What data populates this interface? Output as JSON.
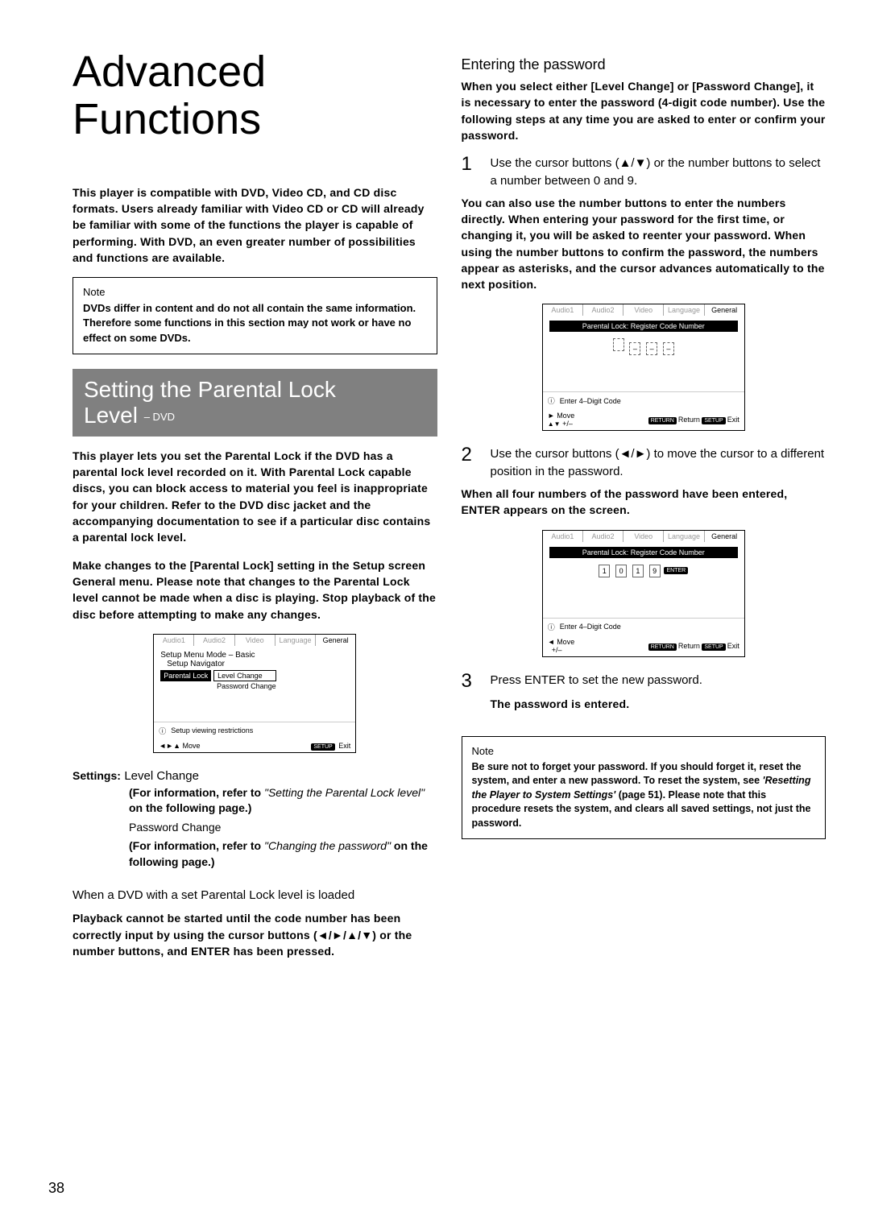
{
  "page_number": "38",
  "title": "Advanced Functions",
  "intro_para": "This player is compatible with DVD, Video CD, and CD disc formats. Users already familiar with Video CD or CD will already be familiar with some of the functions the player is capable of performing. With DVD, an even greater number of possibilities and functions are available.",
  "note1": {
    "label": "Note",
    "text": "DVDs differ in content and do not all contain the same information. Therefore some functions in this section may not work or have no effect on some DVDs."
  },
  "section_banner": {
    "line1": "Setting the Parental Lock",
    "line2_a": "Level",
    "line2_b": "– DVD"
  },
  "parental_para1": "This player lets you set the Parental Lock if the DVD has a parental lock level recorded on it. With Parental Lock capable discs, you can block access to material you feel is inappropriate for your children. Refer to the DVD disc jacket and the accompanying documentation to see if a particular disc contains a parental lock level.",
  "parental_para2": "Make changes to the [Parental Lock] setting in the Setup screen General menu. Please note that changes to the Parental Lock level cannot be made when a disc is playing. Stop playback of the disc before attempting to make any changes.",
  "ui1": {
    "tabs": [
      "Audio1",
      "Audio2",
      "Video",
      "Language",
      "General"
    ],
    "row1": "Setup Menu Mode – Basic",
    "row2": "Setup Navigator",
    "row3_label": "Parental Lock",
    "row3_opt1": "Level Change",
    "row3_opt2": "Password Change",
    "info": "Setup viewing restrictions",
    "footer_move": "Move",
    "footer_setup": "SETUP",
    "footer_exit": "Exit"
  },
  "settings_heading": "Settings:",
  "settings": {
    "item1_name": "Level Change",
    "item1_note_a": "(For information, refer to ",
    "item1_note_b": "\"Setting the Parental Lock level\"",
    "item1_note_c": " on the following page.)",
    "item2_name": "Password Change",
    "item2_note_a": "(For information, refer to ",
    "item2_note_b": "\"Changing the password\"",
    "item2_note_c": " on the following page.)"
  },
  "loaded_h": "When a DVD with a set Parental Lock level is loaded",
  "loaded_para": "Playback cannot be started until the code number has been correctly input by using the cursor buttons (◄/►/▲/▼) or the number buttons, and ENTER has been pressed.",
  "right": {
    "heading": "Entering the password",
    "intro": "When you select either [Level Change] or [Password Change], it is necessary to enter the password (4-digit code number). Use the following steps at any time you are asked to enter or confirm your password.",
    "step1_body": "Use the cursor buttons (▲/▼) or the number buttons to select a number between 0 and 9.",
    "step1_note": "You can also use the number buttons to enter the numbers directly. When entering your password for the first time, or changing it, you will be asked to reenter your password. When using the number buttons to confirm the password, the numbers appear as asterisks, and the cursor advances automatically to the next position.",
    "ui2": {
      "tabs": [
        "Audio1",
        "Audio2",
        "Video",
        "Language",
        "General"
      ],
      "bar": "Parental Lock: Register Code Number",
      "info": "Enter 4–Digit Code",
      "move": "Move",
      "plusminus": "+/–",
      "return_chip": "RETURN",
      "return": "Return",
      "setup_chip": "SETUP",
      "exit": "Exit"
    },
    "step2_body": "Use the cursor buttons (◄/►) to move the cursor to a different position in the password.",
    "step2_note": "When all four numbers of the password have been entered, ENTER appears on the screen.",
    "ui3": {
      "tabs": [
        "Audio1",
        "Audio2",
        "Video",
        "Language",
        "General"
      ],
      "bar": "Parental Lock: Register Code Number",
      "digits": [
        "1",
        "0",
        "1",
        "9"
      ],
      "enter": "ENTER",
      "info": "Enter 4–Digit Code",
      "move": "Move",
      "plusminus": "+/–",
      "return_chip": "RETURN",
      "return": "Return",
      "setup_chip": "SETUP",
      "exit": "Exit"
    },
    "step3_body": "Press ENTER to set the new password.",
    "step3_note": "The password is entered.",
    "note2": {
      "label": "Note",
      "text_a": "Be sure not to forget your password. If you should forget it, reset the system, and enter a new password. To reset the system, see ",
      "text_b": "'Resetting the Player to System Settings'",
      "text_c": " (page 51). Please note that this procedure resets the system, and clears all saved settings, not just the password."
    }
  }
}
